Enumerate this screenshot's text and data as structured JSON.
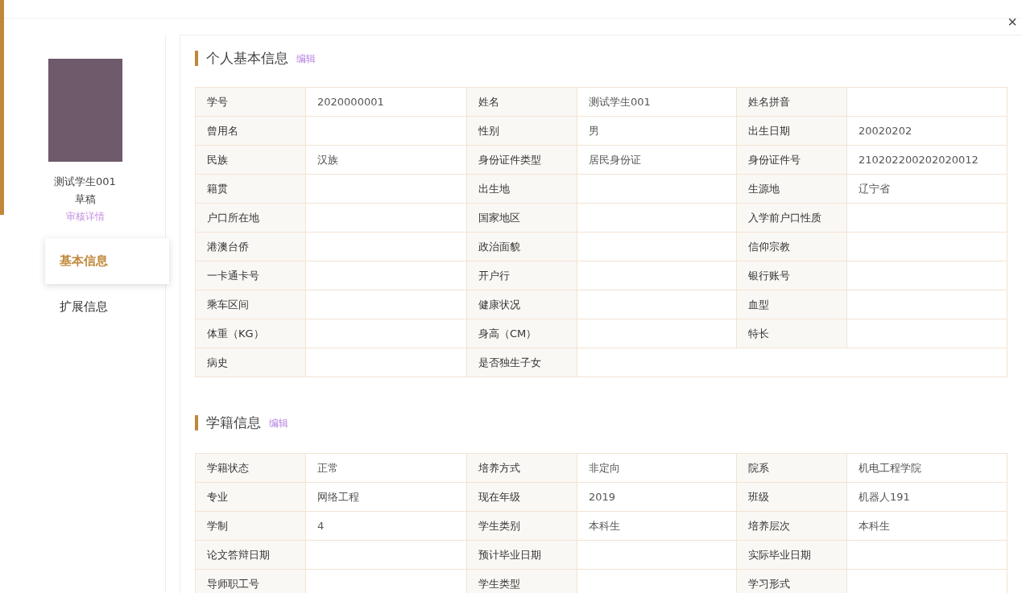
{
  "close_button": "×",
  "profile": {
    "name": "测试学生001",
    "status": "草稿",
    "audit_link": "审核详情"
  },
  "nav": [
    {
      "label": "基本信息",
      "selected": true
    },
    {
      "label": "扩展信息",
      "selected": false
    }
  ],
  "sections": [
    {
      "title": "个人基本信息",
      "edit": "编辑",
      "rows": [
        [
          {
            "label": "学号",
            "value": "2020000001"
          },
          {
            "label": "姓名",
            "value": "测试学生001"
          },
          {
            "label": "姓名拼音"
          }
        ],
        [
          {
            "label": "曾用名"
          },
          {
            "label": "性别",
            "value": "男"
          },
          {
            "label": "出生日期",
            "value": "20020202"
          }
        ],
        [
          {
            "label": "民族",
            "value": "汉族"
          },
          {
            "label": "身份证件类型",
            "value": "居民身份证"
          },
          {
            "label": "身份证件号",
            "value": "210202200202020012"
          }
        ],
        [
          {
            "label": "籍贯"
          },
          {
            "label": "出生地"
          },
          {
            "label": "生源地",
            "value": "辽宁省"
          }
        ],
        [
          {
            "label": "户口所在地"
          },
          {
            "label": "国家地区"
          },
          {
            "label": "入学前户口性质"
          }
        ],
        [
          {
            "label": "港澳台侨"
          },
          {
            "label": "政治面貌"
          },
          {
            "label": "信仰宗教"
          }
        ],
        [
          {
            "label": "一卡通卡号"
          },
          {
            "label": "开户行"
          },
          {
            "label": "银行账号"
          }
        ],
        [
          {
            "label": "乘车区间"
          },
          {
            "label": "健康状况"
          },
          {
            "label": "血型"
          }
        ],
        [
          {
            "label": "体重（KG）"
          },
          {
            "label": "身高（CM）"
          },
          {
            "label": "特长"
          }
        ],
        [
          {
            "label": "病史"
          },
          {
            "label": "是否独生子女"
          }
        ]
      ]
    },
    {
      "title": "学籍信息",
      "edit": "编辑",
      "rows": [
        [
          {
            "label": "学籍状态",
            "value": "正常"
          },
          {
            "label": "培养方式",
            "value": "非定向"
          },
          {
            "label": "院系",
            "value": "机电工程学院"
          }
        ],
        [
          {
            "label": "专业",
            "value": "网络工程"
          },
          {
            "label": "现在年级",
            "value": "2019"
          },
          {
            "label": "班级",
            "value": "机器人191"
          }
        ],
        [
          {
            "label": "学制",
            "value": "4"
          },
          {
            "label": "学生类别",
            "value": "本科生"
          },
          {
            "label": "培养层次",
            "value": "本科生"
          }
        ],
        [
          {
            "label": "论文答辩日期"
          },
          {
            "label": "预计毕业日期"
          },
          {
            "label": "实际毕业日期"
          }
        ],
        [
          {
            "label": "导师职工号"
          },
          {
            "label": "学生类型"
          },
          {
            "label": "学习形式"
          }
        ]
      ]
    }
  ]
}
